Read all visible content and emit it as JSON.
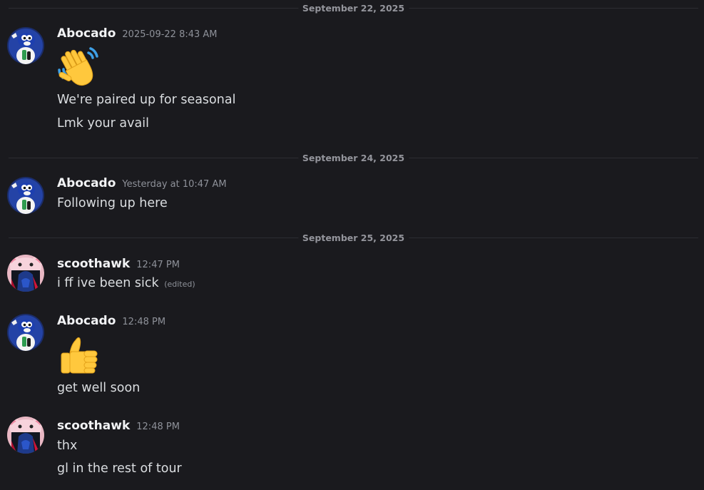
{
  "dividers": [
    {
      "label": "September 22, 2025"
    },
    {
      "label": "September 24, 2025"
    },
    {
      "label": "September 25, 2025"
    }
  ],
  "messages": [
    {
      "author": "Abocado",
      "timestamp": "2025-09-22 8:43 AM",
      "avatar": "bird-mascot-avatar",
      "emoji": "waving-hand-emoji",
      "lines": [
        "We're paired up for seasonal",
        "Lmk your avail"
      ]
    },
    {
      "author": "Abocado",
      "timestamp": "Yesterday at 10:47 AM",
      "avatar": "bird-mascot-avatar",
      "lines": [
        "Following up here"
      ]
    },
    {
      "author": "scoothawk",
      "timestamp": "12:47 PM",
      "avatar": "pink-bear-hood-avatar",
      "lines": [
        "i ff ive been sick"
      ],
      "edited": "(edited)"
    },
    {
      "author": "Abocado",
      "timestamp": "12:48 PM",
      "avatar": "bird-mascot-avatar",
      "emoji": "thumbs-up-emoji",
      "lines": [
        "get well soon"
      ]
    },
    {
      "author": "scoothawk",
      "timestamp": "12:48 PM",
      "avatar": "pink-bear-hood-avatar",
      "lines": [
        "thx",
        "gl in the rest of tour"
      ]
    }
  ],
  "colors": {
    "background": "#1a1a1e",
    "author": "#f2f3f5",
    "text": "#dbdee1",
    "muted": "#8e9199",
    "divider_line": "#2c2d32"
  }
}
